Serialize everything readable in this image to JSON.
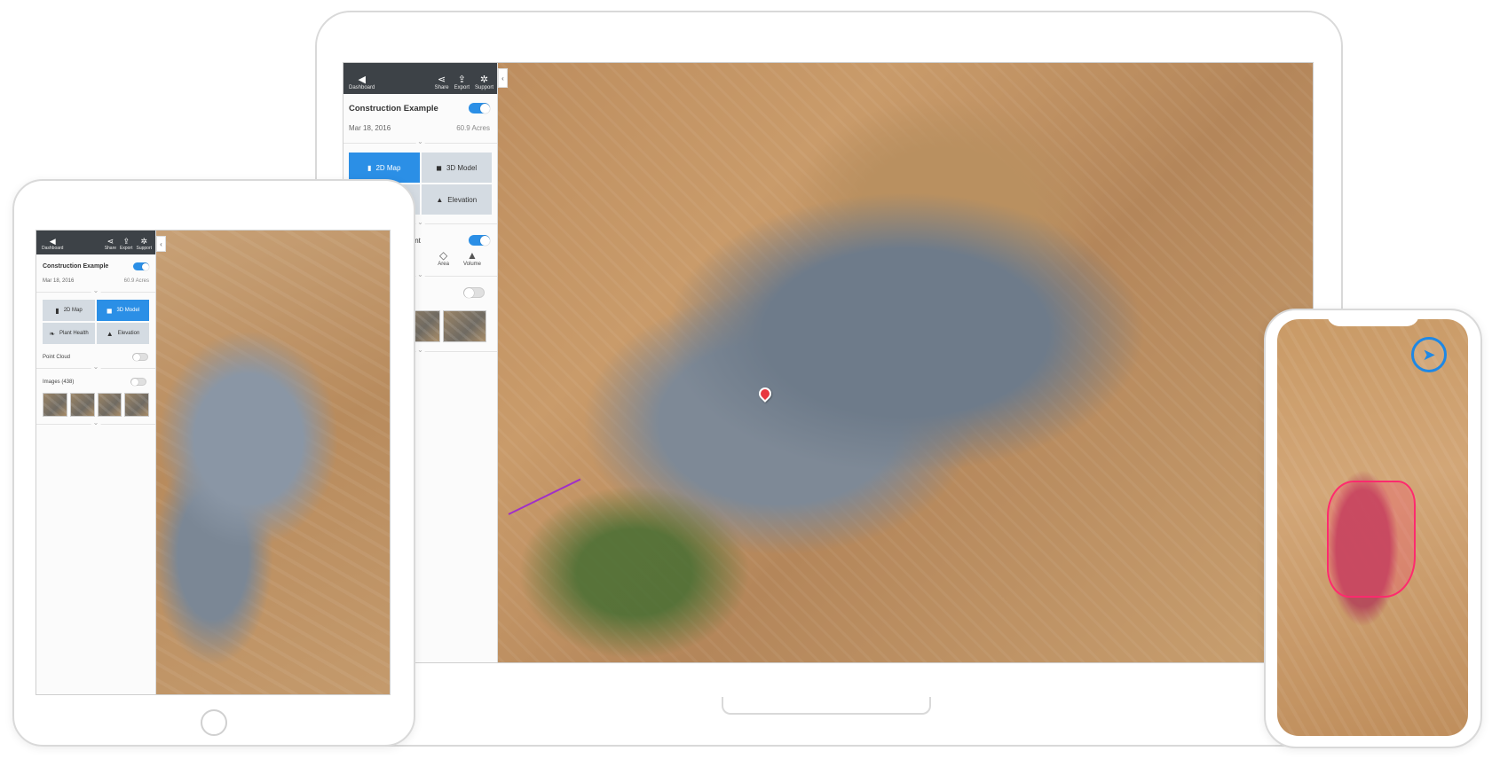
{
  "panel": {
    "nav": {
      "dashboard_label": "Dashboard",
      "share_label": "Share",
      "export_label": "Export",
      "support_label": "Support"
    },
    "project_title": "Construction Example",
    "date": "Mar 18, 2016",
    "area": "60.9 Acres",
    "view_tiles_laptop": {
      "map_2d": "2D Map",
      "model_3d": "3D Model",
      "elevation": "Elevation"
    },
    "view_tiles_tablet": {
      "map_2d": "2D Map",
      "model_3d": "3D Model",
      "plant_health": "Plant Health",
      "elevation": "Elevation"
    },
    "measurement_label": "rement",
    "measure_tools": {
      "area": "Area",
      "volume": "Volume"
    },
    "point_cloud_label": "Point Cloud",
    "images_label": "Images (438)"
  },
  "icons": {
    "back": "back-arrow-icon",
    "share": "share-icon",
    "export": "export-icon",
    "support": "lifebuoy-icon",
    "collapse": "chevron-left-icon",
    "compass": "navigation-arrow-icon",
    "pin": "map-pin-icon"
  },
  "colors": {
    "accent": "#2b8fe6",
    "topbar": "#3d4247",
    "tile_inactive": "#d4dbe2",
    "pin": "#e8363f",
    "measure_line": "#a030c8",
    "volume_outline": "#ff2a6e"
  }
}
